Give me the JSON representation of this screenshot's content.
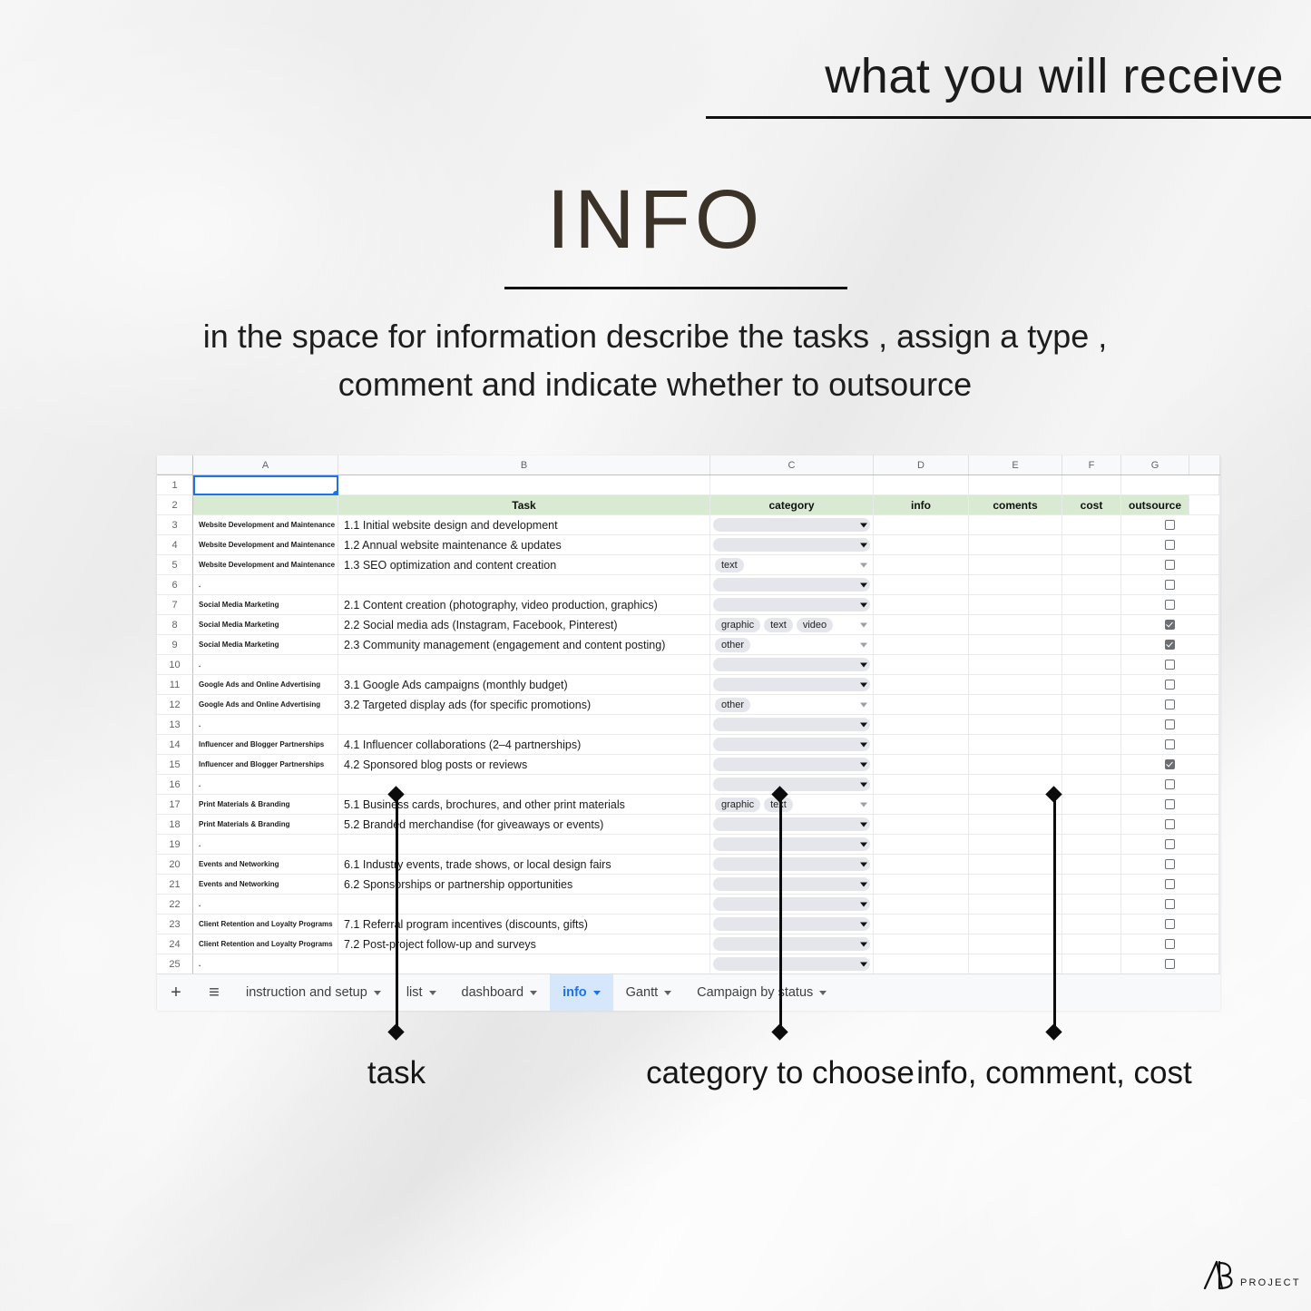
{
  "header": {
    "title": "what you will receive"
  },
  "info": {
    "title": "INFO",
    "description": "in the space for information describe the tasks , assign a type , comment and indicate whether to outsource"
  },
  "spreadsheet": {
    "column_letters": [
      "A",
      "B",
      "C",
      "D",
      "E",
      "F",
      "G"
    ],
    "header_row_index": 2,
    "headers": {
      "a": "",
      "b": "Task",
      "c": "category",
      "d": "info",
      "e": "coments",
      "f": "cost",
      "g": "outsource"
    },
    "header_fill": "#d9ead3",
    "selection_color": "#1a73e8",
    "rows": [
      {
        "n": "1",
        "a": "",
        "b": "",
        "chips": [],
        "checked": false,
        "empty": true
      },
      {
        "n": "2",
        "header": true
      },
      {
        "n": "3",
        "a": "Website Development and Maintenance",
        "b": "1.1 Initial website design and development",
        "chips": [],
        "checked": false
      },
      {
        "n": "4",
        "a": "Website Development and Maintenance",
        "b": "1.2 Annual website maintenance & updates",
        "chips": [],
        "checked": false
      },
      {
        "n": "5",
        "a": "Website Development and Maintenance",
        "b": "1.3 SEO optimization and content creation",
        "chips": [
          "text"
        ],
        "checked": false
      },
      {
        "n": "6",
        "a": ".",
        "b": "",
        "chips": [],
        "checked": false
      },
      {
        "n": "7",
        "a": "Social Media Marketing",
        "b": "2.1 Content creation (photography, video production, graphics)",
        "chips": [],
        "checked": false
      },
      {
        "n": "8",
        "a": "Social Media Marketing",
        "b": "2.2 Social media ads (Instagram, Facebook, Pinterest)",
        "chips": [
          "graphic",
          "text",
          "video"
        ],
        "checked": true
      },
      {
        "n": "9",
        "a": "Social Media Marketing",
        "b": "2.3 Community management (engagement and content posting)",
        "chips": [
          "other"
        ],
        "checked": true
      },
      {
        "n": "10",
        "a": ".",
        "b": "",
        "chips": [],
        "checked": false
      },
      {
        "n": "11",
        "a": "Google Ads and Online Advertising",
        "b": "3.1 Google Ads campaigns (monthly budget)",
        "chips": [],
        "checked": false
      },
      {
        "n": "12",
        "a": "Google Ads and Online Advertising",
        "b": "3.2 Targeted display ads (for specific promotions)",
        "chips": [
          "other"
        ],
        "checked": false
      },
      {
        "n": "13",
        "a": ".",
        "b": "",
        "chips": [],
        "checked": false
      },
      {
        "n": "14",
        "a": "Influencer and Blogger Partnerships",
        "b": "4.1 Influencer collaborations (2–4 partnerships)",
        "chips": [],
        "checked": false
      },
      {
        "n": "15",
        "a": "Influencer and Blogger Partnerships",
        "b": "4.2 Sponsored blog posts or reviews",
        "chips": [],
        "checked": true
      },
      {
        "n": "16",
        "a": ".",
        "b": "",
        "chips": [],
        "checked": false
      },
      {
        "n": "17",
        "a": "Print Materials & Branding",
        "b": "5.1 Business cards, brochures, and other print materials",
        "chips": [
          "graphic",
          "text"
        ],
        "checked": false
      },
      {
        "n": "18",
        "a": "Print Materials & Branding",
        "b": "5.2 Branded merchandise (for giveaways or events)",
        "chips": [],
        "checked": false
      },
      {
        "n": "19",
        "a": ".",
        "b": "",
        "chips": [],
        "checked": false
      },
      {
        "n": "20",
        "a": "Events and Networking",
        "b": "6.1 Industry events, trade shows, or local design fairs",
        "chips": [],
        "checked": false
      },
      {
        "n": "21",
        "a": "Events and Networking",
        "b": "6.2 Sponsorships or partnership opportunities",
        "chips": [],
        "checked": false
      },
      {
        "n": "22",
        "a": ".",
        "b": "",
        "chips": [],
        "checked": false
      },
      {
        "n": "23",
        "a": "Client Retention and Loyalty Programs",
        "b": "7.1 Referral program incentives (discounts, gifts)",
        "chips": [],
        "checked": false
      },
      {
        "n": "24",
        "a": "Client Retention and Loyalty Programs",
        "b": "7.2 Post-project follow-up and surveys",
        "chips": [],
        "checked": false
      },
      {
        "n": "25",
        "a": ".",
        "b": "",
        "chips": [],
        "checked": false
      }
    ]
  },
  "tabbar": {
    "add_sheet_icon": "+",
    "all_sheets_icon": "≡",
    "tabs": [
      {
        "label": "instruction and setup",
        "active": false
      },
      {
        "label": "list",
        "active": false
      },
      {
        "label": "dashboard",
        "active": false
      },
      {
        "label": "info",
        "active": true
      },
      {
        "label": "Gantt",
        "active": false
      },
      {
        "label": "Campaign by status",
        "active": false
      }
    ]
  },
  "annotations": [
    {
      "label": "task"
    },
    {
      "label": "category to choose"
    },
    {
      "label": "info, comment, cost"
    }
  ],
  "logo": {
    "mark": "AB",
    "word": "PROJECT"
  }
}
